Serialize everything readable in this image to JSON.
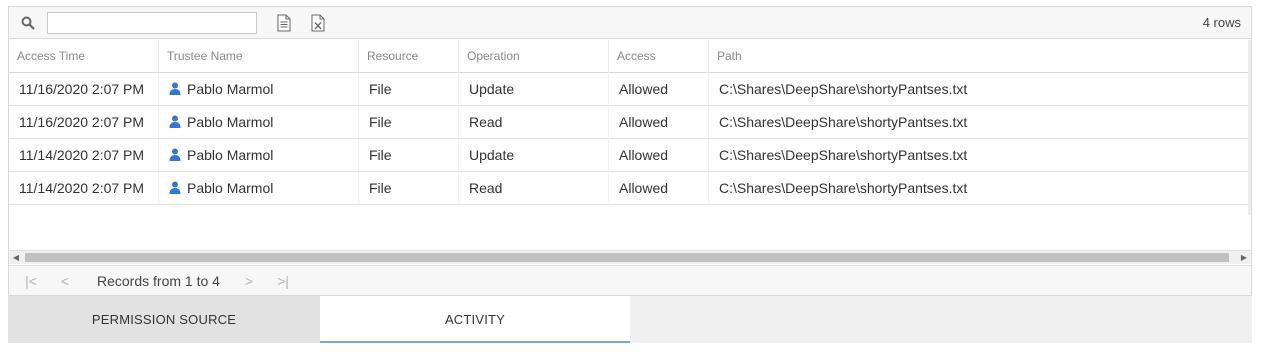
{
  "toolbar": {
    "search_placeholder": "",
    "search_value": "",
    "export_text_icon": "text-document-icon",
    "export_excel_icon": "excel-export-icon",
    "row_count": "4 rows"
  },
  "columns": [
    "Access Time",
    "Trustee Name",
    "Resource",
    "Operation",
    "Access",
    "Path"
  ],
  "rows": [
    {
      "access_time": "11/16/2020 2:07 PM",
      "trustee": "Pablo Marmol",
      "resource": "File",
      "operation": "Update",
      "access": "Allowed",
      "path": "C:\\Shares\\DeepShare\\shortyPantses.txt"
    },
    {
      "access_time": "11/16/2020 2:07 PM",
      "trustee": "Pablo Marmol",
      "resource": "File",
      "operation": "Read",
      "access": "Allowed",
      "path": "C:\\Shares\\DeepShare\\shortyPantses.txt"
    },
    {
      "access_time": "11/14/2020 2:07 PM",
      "trustee": "Pablo Marmol",
      "resource": "File",
      "operation": "Update",
      "access": "Allowed",
      "path": "C:\\Shares\\DeepShare\\shortyPantses.txt"
    },
    {
      "access_time": "11/14/2020 2:07 PM",
      "trustee": "Pablo Marmol",
      "resource": "File",
      "operation": "Read",
      "access": "Allowed",
      "path": "C:\\Shares\\DeepShare\\shortyPantses.txt"
    }
  ],
  "pager": {
    "first": "|<",
    "prev": "<",
    "records_text": "Records from 1 to 4",
    "next": ">",
    "last": ">|"
  },
  "tabs": [
    {
      "label": "PERMISSION SOURCE"
    },
    {
      "label": "ACTIVITY"
    }
  ],
  "colors": {
    "user_icon": "#2f7ad9",
    "tab_active_underline": "#7aa7d8"
  }
}
